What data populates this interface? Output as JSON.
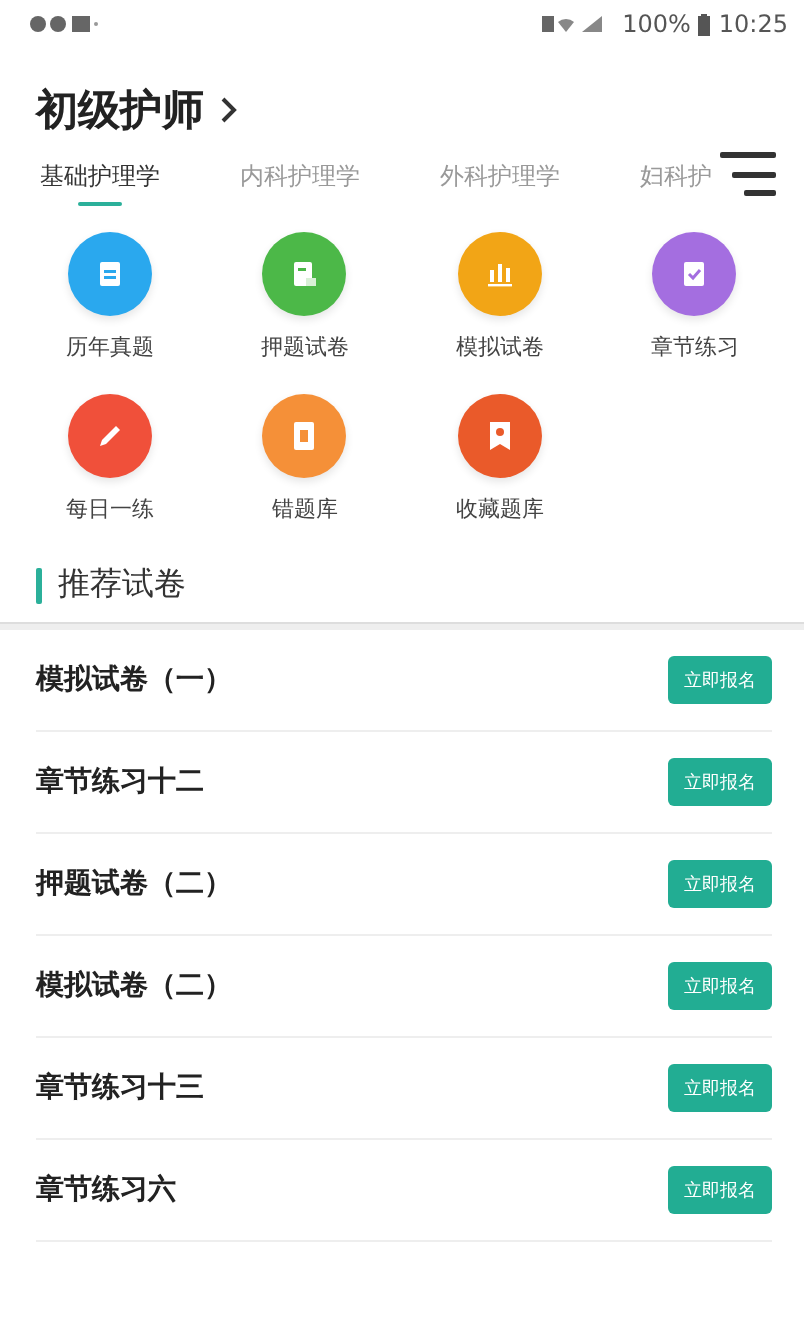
{
  "status_bar": {
    "battery": "100%",
    "time": "10:25"
  },
  "header": {
    "title": "初级护师"
  },
  "tabs": [
    {
      "label": "基础护理学",
      "selected": true
    },
    {
      "label": "内科护理学",
      "selected": false
    },
    {
      "label": "外科护理学",
      "selected": false
    },
    {
      "label": "妇科护",
      "selected": false
    }
  ],
  "shortcuts": [
    {
      "label": "历年真题",
      "kind": "calendar",
      "color": "#2aa8ee"
    },
    {
      "label": "押题试卷",
      "kind": "scroll",
      "color": "#4cb848"
    },
    {
      "label": "模拟试卷",
      "kind": "chart",
      "color": "#f2a516"
    },
    {
      "label": "章节练习",
      "kind": "check",
      "color": "#a46ee0"
    },
    {
      "label": "每日一练",
      "kind": "pencil",
      "color": "#f0503a"
    },
    {
      "label": "错题库",
      "kind": "book",
      "color": "#f59038"
    },
    {
      "label": "收藏题库",
      "kind": "ribbon",
      "color": "#ea5a2a"
    }
  ],
  "section": {
    "title": "推荐试卷"
  },
  "papers": [
    {
      "title": "模拟试卷（一）",
      "action": "立即报名"
    },
    {
      "title": "章节练习十二",
      "action": "立即报名"
    },
    {
      "title": "押题试卷（二）",
      "action": "立即报名"
    },
    {
      "title": "模拟试卷（二）",
      "action": "立即报名"
    },
    {
      "title": "章节练习十三",
      "action": "立即报名"
    },
    {
      "title": "章节练习六",
      "action": "立即报名"
    }
  ]
}
